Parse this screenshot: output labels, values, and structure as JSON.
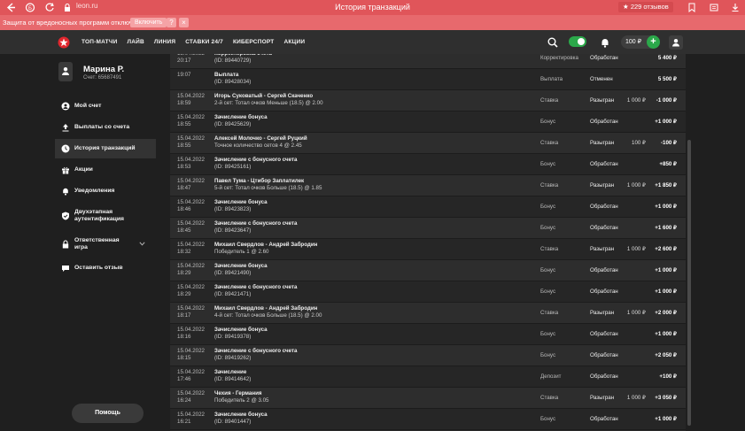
{
  "browser": {
    "url": "leon.ru",
    "window_title": "История транзакций",
    "reviews": "229 отзывов"
  },
  "security_bar": {
    "text": "Защита от вредоносных программ отключена",
    "enable_label": "Включить",
    "help_label": "?",
    "close_label": "×"
  },
  "header": {
    "menu": [
      "ТОП-МАТЧИ",
      "ЛАЙВ",
      "ЛИНИЯ",
      "СТАВКИ 24/7",
      "КИБЕРСПОРТ",
      "АКЦИИ"
    ],
    "balance": "100 ₽",
    "plus": "+"
  },
  "profile": {
    "name": "Марина Р.",
    "account": "Счет: 65687491"
  },
  "sidebar": {
    "items": [
      {
        "label": "Мой счет",
        "icon": "user-circle-icon"
      },
      {
        "label": "Выплаты со счета",
        "icon": "upload-icon"
      },
      {
        "label": "История транзакций",
        "icon": "clock-icon"
      },
      {
        "label": "Акции",
        "icon": "gift-icon"
      },
      {
        "label": "Уведомления",
        "icon": "bell-icon"
      },
      {
        "label": "Двухэтапная\nаутентификация",
        "icon": "shield-check-icon"
      },
      {
        "label": "Ответственная\nигра",
        "icon": "lock-icon"
      },
      {
        "label": "Оставить отзыв",
        "icon": "chat-icon"
      }
    ],
    "help_button": "Помощь"
  },
  "transactions": [
    {
      "date": "15.04.2022",
      "time": "20:17",
      "title": "Корректировка счета",
      "sub": "(ID: 89440729)",
      "category": "Корректировка",
      "status": "Обработан",
      "bet": "",
      "result": "5 400 ₽"
    },
    {
      "date": "",
      "time": "19:07",
      "title": "Выплата",
      "sub": "(ID: 89428034)",
      "category": "Выплата",
      "status": "Отменен",
      "bet": "",
      "result": "5 500 ₽"
    },
    {
      "date": "15.04.2022",
      "time": "18:59",
      "title": "Игорь Суковатый - Сергей Скаченко",
      "sub": "2-й сет: Тотал очков Меньше (18.5) @ 2.00",
      "category": "Ставка",
      "status": "Разыгран",
      "bet": "1 000 ₽",
      "result": "-1 000 ₽"
    },
    {
      "date": "15.04.2022",
      "time": "18:55",
      "title": "Зачисление бонуса",
      "sub": "(ID: 89425629)",
      "category": "Бонус",
      "status": "Обработан",
      "bet": "",
      "result": "+1 000 ₽"
    },
    {
      "date": "15.04.2022",
      "time": "18:55",
      "title": "Алексей Молочко - Сергей Руцкий",
      "sub": "Точное количество сетов 4 @ 2.45",
      "category": "Ставка",
      "status": "Разыгран",
      "bet": "100 ₽",
      "result": "-100 ₽"
    },
    {
      "date": "15.04.2022",
      "time": "18:53",
      "title": "Зачисление с бонусного счета",
      "sub": "(ID: 89425161)",
      "category": "Бонус",
      "status": "Обработан",
      "bet": "",
      "result": "+850 ₽"
    },
    {
      "date": "15.04.2022",
      "time": "18:47",
      "title": "Павел Тума - Цтибор Заплатилек",
      "sub": "5-й сет: Тотал очков Больше (18.5) @ 1.85",
      "category": "Ставка",
      "status": "Разыгран",
      "bet": "1 000 ₽",
      "result": "+1 850 ₽"
    },
    {
      "date": "15.04.2022",
      "time": "18:46",
      "title": "Зачисление бонуса",
      "sub": "(ID: 89423823)",
      "category": "Бонус",
      "status": "Обработан",
      "bet": "",
      "result": "+1 000 ₽"
    },
    {
      "date": "15.04.2022",
      "time": "18:45",
      "title": "Зачисление с бонусного счета",
      "sub": "(ID: 89423647)",
      "category": "Бонус",
      "status": "Обработан",
      "bet": "",
      "result": "+1 600 ₽"
    },
    {
      "date": "15.04.2022",
      "time": "18:32",
      "title": "Михаил Свердлов - Андрей Забродин",
      "sub": "Победитель 1 @ 2.60",
      "category": "Ставка",
      "status": "Разыгран",
      "bet": "1 000 ₽",
      "result": "+2 600 ₽"
    },
    {
      "date": "15.04.2022",
      "time": "18:29",
      "title": "Зачисление бонуса",
      "sub": "(ID: 89421490)",
      "category": "Бонус",
      "status": "Обработан",
      "bet": "",
      "result": "+1 000 ₽"
    },
    {
      "date": "15.04.2022",
      "time": "18:29",
      "title": "Зачисление с бонусного счета",
      "sub": "(ID: 89421471)",
      "category": "Бонус",
      "status": "Обработан",
      "bet": "",
      "result": "+1 000 ₽"
    },
    {
      "date": "15.04.2022",
      "time": "18:17",
      "title": "Михаил Свердлов - Андрей Забродин",
      "sub": "4-й сет: Тотал очков Больше (18.5) @ 2.00",
      "category": "Ставка",
      "status": "Разыгран",
      "bet": "1 000 ₽",
      "result": "+2 000 ₽"
    },
    {
      "date": "15.04.2022",
      "time": "18:16",
      "title": "Зачисление бонуса",
      "sub": "(ID: 89419378)",
      "category": "Бонус",
      "status": "Обработан",
      "bet": "",
      "result": "+1 000 ₽"
    },
    {
      "date": "15.04.2022",
      "time": "18:15",
      "title": "Зачисление с бонусного счета",
      "sub": "(ID: 89419262)",
      "category": "Бонус",
      "status": "Обработан",
      "bet": "",
      "result": "+2 050 ₽"
    },
    {
      "date": "15.04.2022",
      "time": "17:46",
      "title": "Зачисление",
      "sub": "(ID: 89414642)",
      "category": "Депозит",
      "status": "Обработан",
      "bet": "",
      "result": "+100 ₽"
    },
    {
      "date": "15.04.2022",
      "time": "16:24",
      "title": "Чехия - Германия",
      "sub": "Победитель 2 @ 3.05",
      "category": "Ставка",
      "status": "Разыгран",
      "bet": "1 000 ₽",
      "result": "+3 050 ₽"
    },
    {
      "date": "15.04.2022",
      "time": "16:21",
      "title": "Зачисление бонуса",
      "sub": "(ID: 89401447)",
      "category": "Бонус",
      "status": "Обработан",
      "bet": "",
      "result": "+1 000 ₽"
    }
  ],
  "colors": {
    "browser_bar": "#e0555a",
    "accent_green": "#2ba84a",
    "brand_red": "#e0262d"
  }
}
